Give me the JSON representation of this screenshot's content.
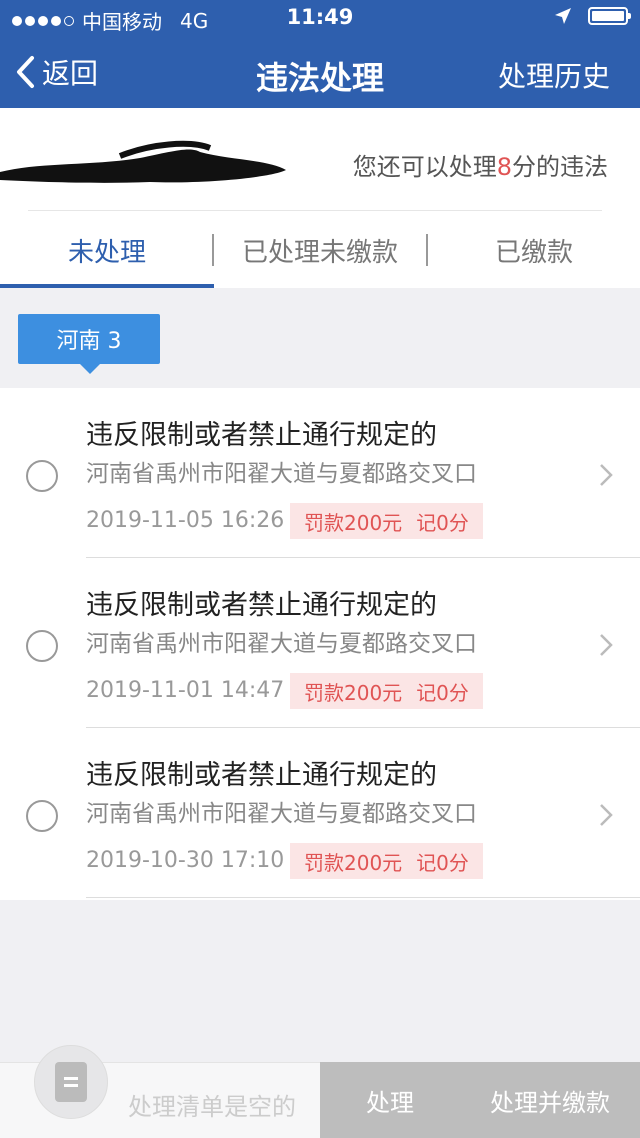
{
  "status_bar": {
    "carrier": "中国移动",
    "network": "4G",
    "time": "11:49"
  },
  "nav": {
    "back_label": "返回",
    "title": "违法处理",
    "history_label": "处理历史"
  },
  "header": {
    "points_prefix": "您还可以处理",
    "points_value": "8",
    "points_suffix": "分的违法"
  },
  "tabs": [
    {
      "label": "未处理",
      "active": true
    },
    {
      "label": "已处理未缴款",
      "active": false
    },
    {
      "label": "已缴款",
      "active": false
    }
  ],
  "region_badge": "河南 3",
  "violations": [
    {
      "title": "违反限制或者禁止通行规定的",
      "location": "河南省禹州市阳翟大道与夏都路交叉口",
      "datetime": "2019-11-05 16:26",
      "fine": "罚款200元",
      "points": "记0分"
    },
    {
      "title": "违反限制或者禁止通行规定的",
      "location": "河南省禹州市阳翟大道与夏都路交叉口",
      "datetime": "2019-11-01 14:47",
      "fine": "罚款200元",
      "points": "记0分"
    },
    {
      "title": "违反限制或者禁止通行规定的",
      "location": "河南省禹州市阳翟大道与夏都路交叉口",
      "datetime": "2019-10-30 17:10",
      "fine": "罚款200元",
      "points": "记0分"
    }
  ],
  "bottom_bar": {
    "empty_text": "处理清单是空的",
    "process_label": "处理",
    "process_pay_label": "处理并缴款"
  },
  "colors": {
    "primary": "#2e5fae",
    "badge_blue": "#3d8fe0",
    "fine_red": "#e05454",
    "fine_bg": "#fbe5e5",
    "disabled_button": "#bdbdbd"
  }
}
